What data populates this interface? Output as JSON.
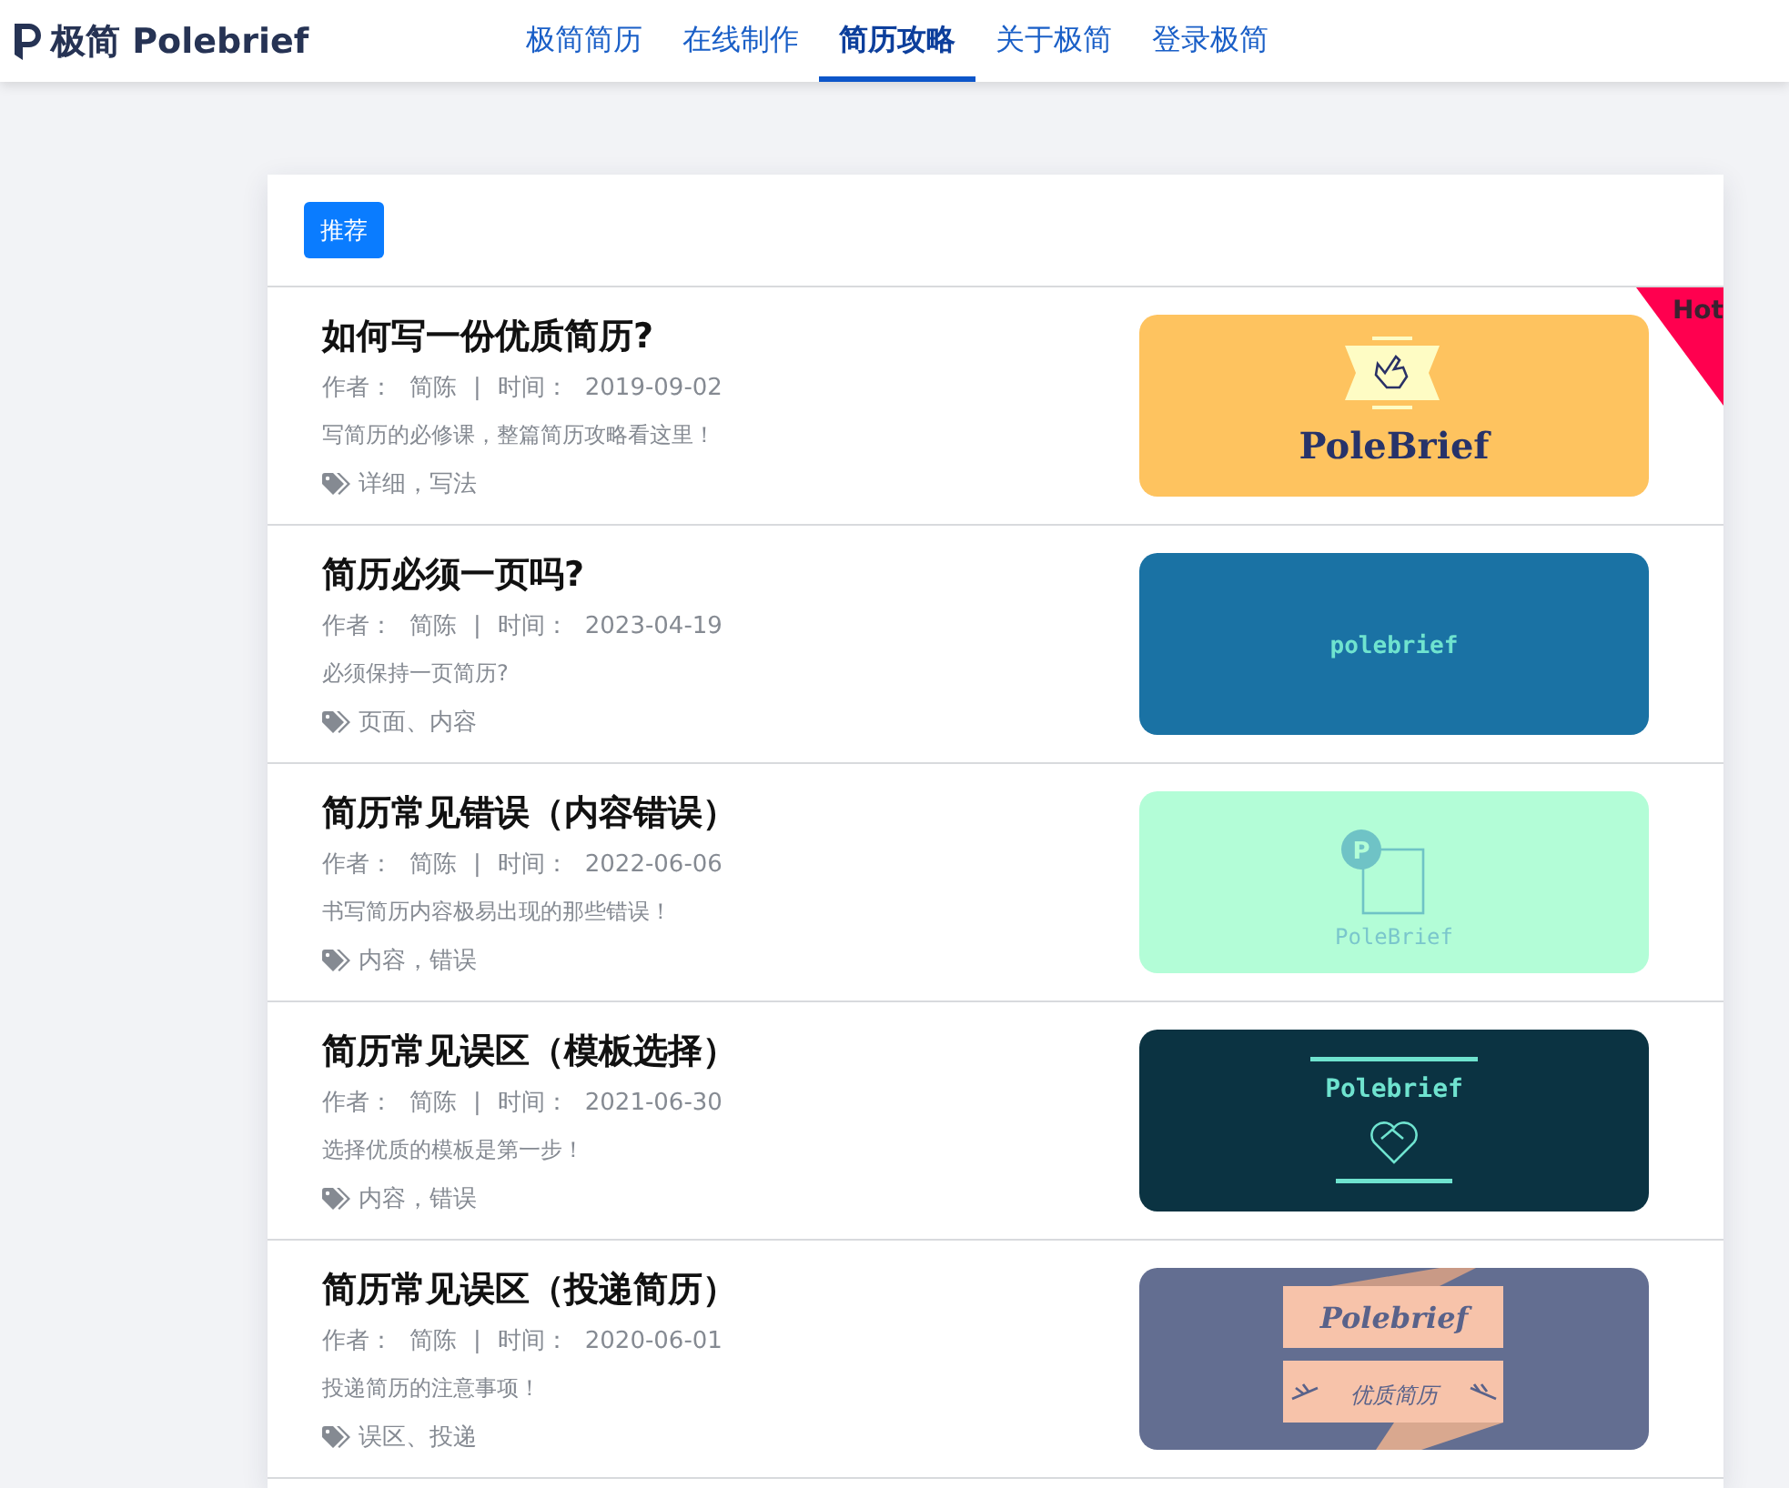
{
  "header": {
    "brand": "极简 Polebrief",
    "nav": [
      {
        "label": "极简简历",
        "selected": false
      },
      {
        "label": "在线制作",
        "selected": false
      },
      {
        "label": "简历攻略",
        "selected": true
      },
      {
        "label": "关于极简",
        "selected": false
      },
      {
        "label": "登录极简",
        "selected": false
      }
    ]
  },
  "filter": {
    "label": "推荐"
  },
  "articles": [
    {
      "title": "如何写一份优质简历?",
      "author_label": "作者：",
      "author": "简陈",
      "separator": "|",
      "date_label": "时间：",
      "date": "2019-09-02",
      "summary": "写简历的必修课，整篇简历攻略看这里！",
      "tags": "详细，写法",
      "badge": "Hot",
      "thumbnail": {
        "kind": "hand",
        "texts": [
          "PoleBrief"
        ]
      }
    },
    {
      "title": "简历必须一页吗?",
      "author_label": "作者：",
      "author": "简陈",
      "separator": "|",
      "date_label": "时间：",
      "date": "2023-04-19",
      "summary": "必须保持一页简历?",
      "tags": "页面、内容",
      "thumbnail": {
        "kind": "mono",
        "texts": [
          "polebrief"
        ]
      }
    },
    {
      "title": "简历常见错误（内容错误）",
      "author_label": "作者：",
      "author": "简陈",
      "separator": "|",
      "date_label": "时间：",
      "date": "2022-06-06",
      "summary": "书写简历内容极易出现的那些错误！",
      "tags": "内容，错误",
      "thumbnail": {
        "kind": "square",
        "texts": [
          "P",
          "PoleBrief"
        ]
      }
    },
    {
      "title": "简历常见误区（模板选择）",
      "author_label": "作者：",
      "author": "简陈",
      "separator": "|",
      "date_label": "时间：",
      "date": "2021-06-30",
      "summary": "选择优质的模板是第一步！",
      "tags": "内容，错误",
      "thumbnail": {
        "kind": "handshake",
        "texts": [
          "Polebrief"
        ]
      }
    },
    {
      "title": "简历常见误区（投递简历）",
      "author_label": "作者：",
      "author": "简陈",
      "separator": "|",
      "date_label": "时间：",
      "date": "2020-06-01",
      "summary": "投递简历的注意事项！",
      "tags": "误区、投递",
      "thumbnail": {
        "kind": "ribbon",
        "texts": [
          "Polebrief",
          "优质简历"
        ]
      }
    }
  ]
}
